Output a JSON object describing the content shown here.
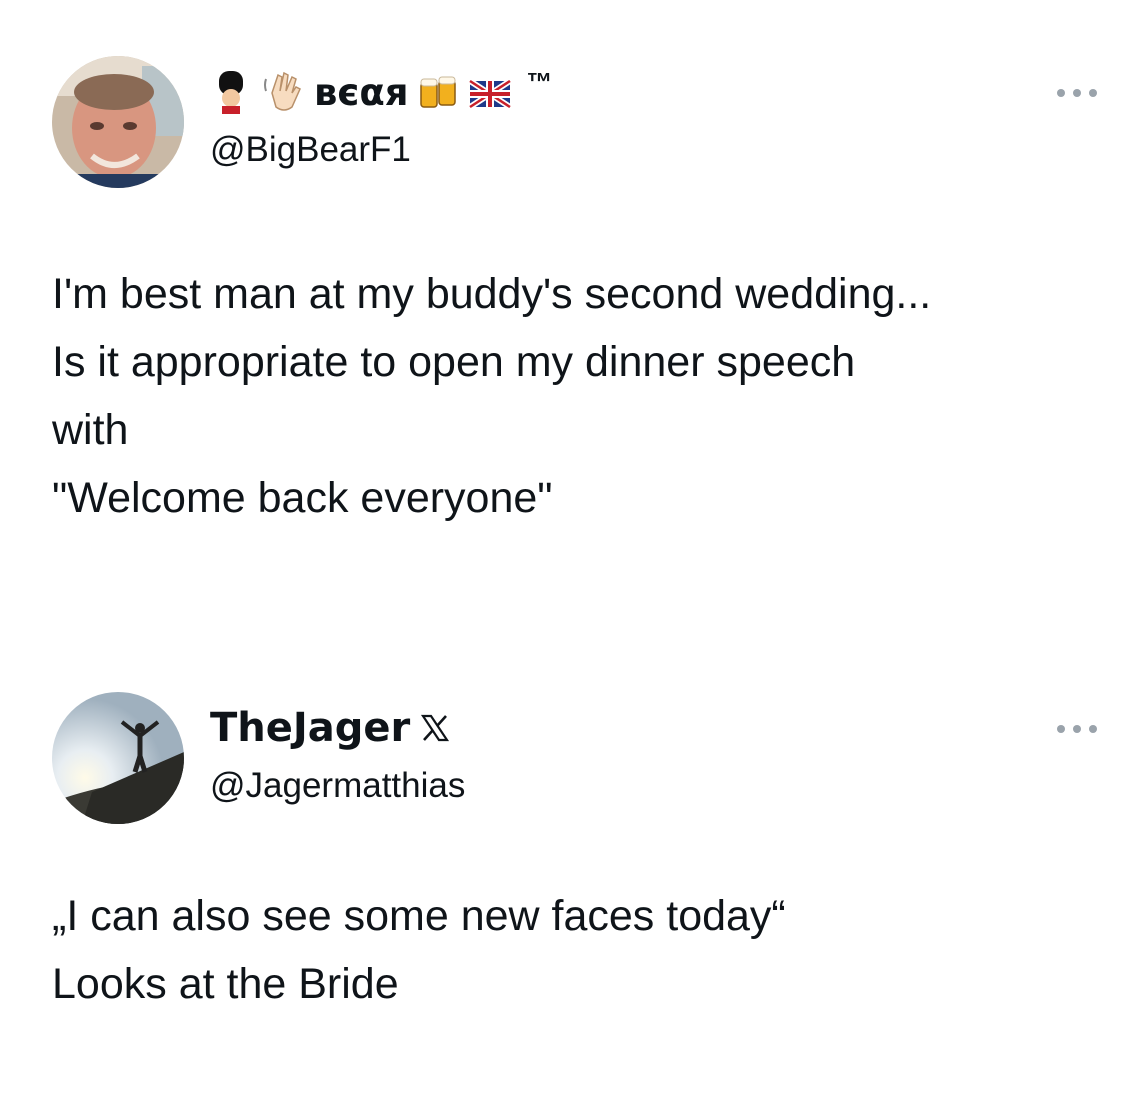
{
  "tweets": [
    {
      "display_name": "вєαя",
      "name_suffix": "™",
      "handle": "@BigBearF1",
      "body_lines": [
        "I'm best man at my buddy's second wedding...",
        "Is it appropriate to open my dinner speech",
        "with",
        "\"Welcome back everyone\""
      ],
      "name_icons": [
        "guard-emoji-icon",
        "waving-hand-emoji-icon",
        "beer-mugs-emoji-icon",
        "uk-flag-emoji-icon"
      ]
    },
    {
      "display_name": "TheJager",
      "handle": "@Jagermatthias",
      "body_lines": [
        "„I can also see some new faces today“",
        "Looks at the Bride"
      ],
      "name_icons": [
        "x-logo-icon"
      ]
    }
  ],
  "colors": {
    "text": "#0f1419",
    "more_dots": "#9aa3ab",
    "background": "#ffffff"
  }
}
